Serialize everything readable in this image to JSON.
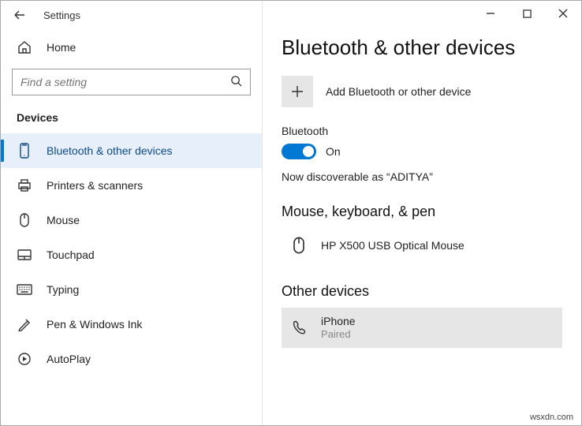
{
  "titlebar": {
    "title": "Settings"
  },
  "home": {
    "label": "Home"
  },
  "search": {
    "placeholder": "Find a setting"
  },
  "section": "Devices",
  "nav": [
    {
      "id": "bluetooth",
      "label": "Bluetooth & other devices",
      "active": true
    },
    {
      "id": "printers",
      "label": "Printers & scanners"
    },
    {
      "id": "mouse",
      "label": "Mouse"
    },
    {
      "id": "touchpad",
      "label": "Touchpad"
    },
    {
      "id": "typing",
      "label": "Typing"
    },
    {
      "id": "pen",
      "label": "Pen & Windows Ink"
    },
    {
      "id": "autoplay",
      "label": "AutoPlay"
    }
  ],
  "main": {
    "title": "Bluetooth & other devices",
    "add_label": "Add Bluetooth or other device",
    "bluetooth_label": "Bluetooth",
    "toggle_state": "On",
    "discoverable": "Now discoverable as “ADITYA”",
    "group_mouse": "Mouse, keyboard, & pen",
    "device_mouse": {
      "name": "HP X500 USB Optical Mouse"
    },
    "group_other": "Other devices",
    "device_other": {
      "name": "iPhone",
      "status": "Paired"
    }
  },
  "watermark": "wsxdn.com"
}
